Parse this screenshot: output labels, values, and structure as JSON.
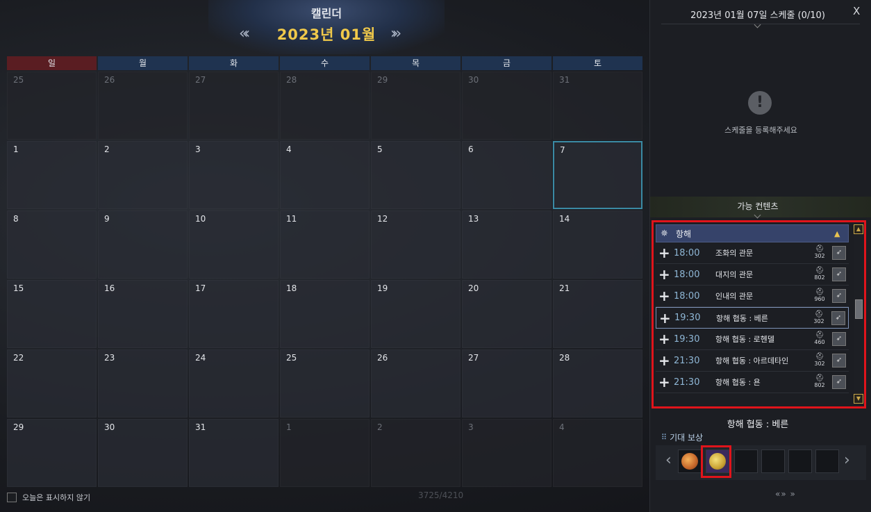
{
  "calendar": {
    "title": "캘린더",
    "month_label": "2023년 01월",
    "prev_icon": "double-chevron-left",
    "next_icon": "double-chevron-right",
    "weekdays": [
      "일",
      "월",
      "화",
      "수",
      "목",
      "금",
      "토"
    ],
    "weeks": [
      [
        {
          "n": "25",
          "dim": true
        },
        {
          "n": "26",
          "dim": true
        },
        {
          "n": "27",
          "dim": true
        },
        {
          "n": "28",
          "dim": true
        },
        {
          "n": "29",
          "dim": true
        },
        {
          "n": "30",
          "dim": true
        },
        {
          "n": "31",
          "dim": true
        }
      ],
      [
        {
          "n": "1"
        },
        {
          "n": "2"
        },
        {
          "n": "3"
        },
        {
          "n": "4"
        },
        {
          "n": "5"
        },
        {
          "n": "6"
        },
        {
          "n": "7",
          "selected": true
        }
      ],
      [
        {
          "n": "8"
        },
        {
          "n": "9"
        },
        {
          "n": "10"
        },
        {
          "n": "11"
        },
        {
          "n": "12"
        },
        {
          "n": "13"
        },
        {
          "n": "14"
        }
      ],
      [
        {
          "n": "15"
        },
        {
          "n": "16"
        },
        {
          "n": "17"
        },
        {
          "n": "18"
        },
        {
          "n": "19"
        },
        {
          "n": "20"
        },
        {
          "n": "21"
        }
      ],
      [
        {
          "n": "22"
        },
        {
          "n": "23"
        },
        {
          "n": "24"
        },
        {
          "n": "25"
        },
        {
          "n": "26"
        },
        {
          "n": "27"
        },
        {
          "n": "28"
        }
      ],
      [
        {
          "n": "29"
        },
        {
          "n": "30"
        },
        {
          "n": "31"
        },
        {
          "n": "1",
          "dim": true
        },
        {
          "n": "2",
          "dim": true
        },
        {
          "n": "3",
          "dim": true
        },
        {
          "n": "4",
          "dim": true
        }
      ]
    ],
    "sunday_color": "#5a1d22",
    "weekday_color": "#1f3350",
    "selected_border_color": "#3a8aa4"
  },
  "footer": {
    "hide_today_label": "오늘은 표시하지 않기",
    "counter": "3725/4210"
  },
  "schedule": {
    "title": "2023년 01월 07일 스케줄 (0/10)",
    "close_label": "X",
    "empty_icon": "exclamation-icon",
    "empty_message": "스케줄을 등록해주세요"
  },
  "available": {
    "title": "가능 컨텐츠",
    "category": {
      "label": "항해",
      "icon": "ship-wheel-icon"
    },
    "items": [
      {
        "time": "18:00",
        "name": "조화의 관문",
        "gear": "302"
      },
      {
        "time": "18:00",
        "name": "대지의 관문",
        "gear": "802"
      },
      {
        "time": "18:00",
        "name": "인내의 관문",
        "gear": "960"
      },
      {
        "time": "19:30",
        "name": "항해 협동 : 베른",
        "gear": "302",
        "active": true
      },
      {
        "time": "19:30",
        "name": "항해 협동 : 로헨델",
        "gear": "460"
      },
      {
        "time": "21:30",
        "name": "항해 협동 : 아르데타인",
        "gear": "302"
      },
      {
        "time": "21:30",
        "name": "항해 협동 : 욘",
        "gear": "802"
      }
    ],
    "highlight_color": "#e0141b"
  },
  "detail": {
    "title": "항해 협동 : 베른",
    "reward_label": "기대 보상",
    "rewards": [
      "coin-copper-icon",
      "coin-gold-icon",
      "",
      "",
      "",
      ""
    ]
  }
}
